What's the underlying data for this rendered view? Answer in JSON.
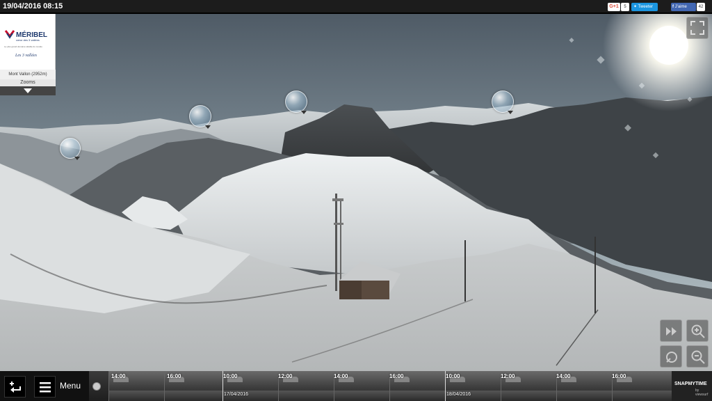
{
  "header": {
    "datetime": "19/04/2016 08:15",
    "share": {
      "gplus_label": "G+1",
      "gplus_count": "5",
      "twitter_label": "Tweeter",
      "facebook_label": "J'aime",
      "facebook_count": "42"
    }
  },
  "logo": {
    "brand": "MÉRIBEL",
    "tagline": "cœur des 3 vallées",
    "subtagline": "Le plus grand domaine skiable du monde",
    "partner": "Les 3 vallées",
    "location": "Mont Vallon (2952m)",
    "zooms_label": "Zooms"
  },
  "footer": {
    "menu_label": "Menu",
    "timeline": {
      "times": [
        "14:00",
        "16:00",
        "10:00",
        "12:00",
        "14:00",
        "16:00",
        "10:00",
        "12:00",
        "14:00",
        "16:00"
      ],
      "days": [
        "17/04/2016",
        "18/04/2016"
      ]
    },
    "brand": "SNAPMYTIME",
    "brand_sub": "by viewsurf"
  },
  "icons": {
    "fullscreen": "fullscreen-icon",
    "share_return": "share-arrow-icon",
    "menu": "hamburger-icon",
    "play": "play-icon",
    "fast_forward": "fast-forward-icon",
    "zoom_in": "zoom-in-icon",
    "rotate": "rotate-icon",
    "zoom_out": "zoom-out-icon"
  }
}
